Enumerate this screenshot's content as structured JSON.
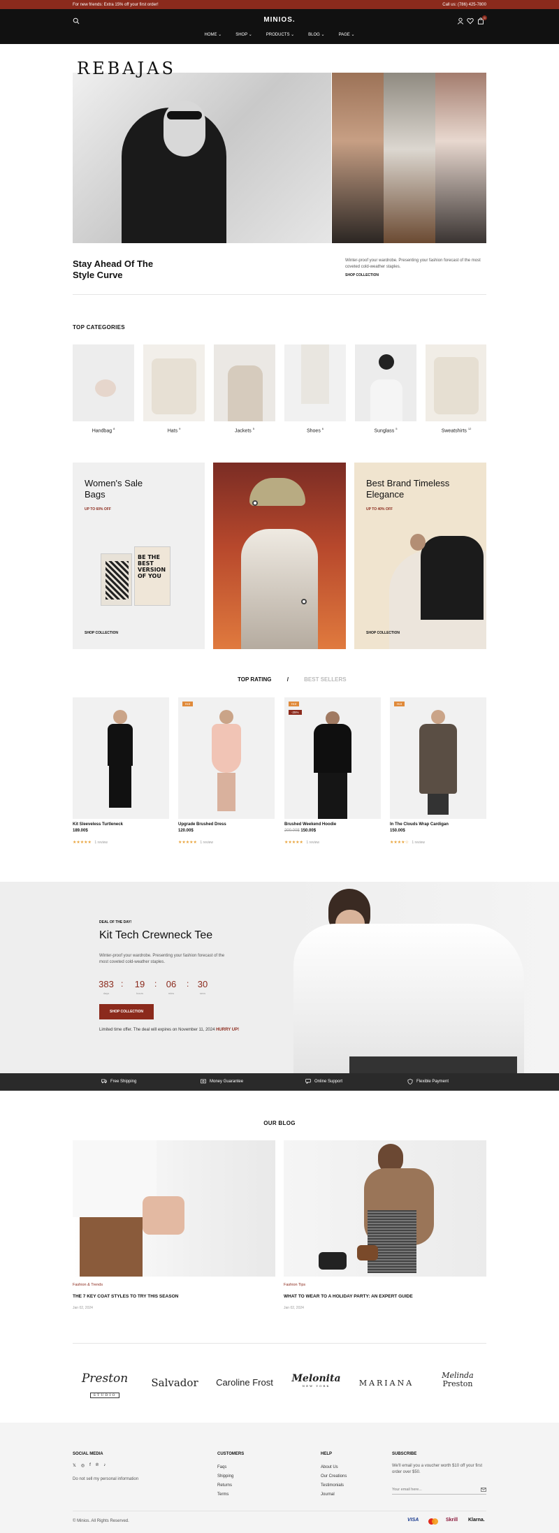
{
  "topbar": {
    "promo": "For new friends: Extra 15% off your first order!",
    "phone": "Call us: (786) 425-7800"
  },
  "header": {
    "brand": "MINIOS.",
    "nav": [
      "HOME",
      "SHOP",
      "PRODUCTS",
      "BLOG",
      "PAGE"
    ],
    "cart_count": "0"
  },
  "hero": {
    "overlay_text": "REBAJAS",
    "title": "Stay Ahead Of The Style Curve",
    "description": "Winter-proof your wardrobe. Presenting your fashion forecast of the most coveted cold-weather staples.",
    "link": "SHOP COLLECTION"
  },
  "categories": {
    "title": "TOP CATEGORIES",
    "items": [
      {
        "name": "Handbag",
        "count": "8"
      },
      {
        "name": "Hats",
        "count": "9"
      },
      {
        "name": "Jackets",
        "count": "5"
      },
      {
        "name": "Shoes",
        "count": "6"
      },
      {
        "name": "Sunglass",
        "count": "5"
      },
      {
        "name": "Sweatshirts",
        "count": "12"
      }
    ]
  },
  "promos": {
    "left": {
      "title": "Women's Sale Bags",
      "subtitle": "UP TO 60% OFF",
      "link": "SHOP COLLECTION",
      "bag_text": "BE THE BEST VERSION OF YOU"
    },
    "right": {
      "title": "Best Brand Timeless Elegance",
      "subtitle": "UP TO 40% OFF",
      "link": "SHOP COLLECTION"
    }
  },
  "products": {
    "tabs": [
      "TOP RATING",
      "/",
      "BEST SELLERS"
    ],
    "items": [
      {
        "name": "Kit Sleeveless Turtleneck",
        "price": "189.00$",
        "old_price": "",
        "badge": "",
        "discount": "",
        "stars": "★★★★★",
        "reviews": "1 review"
      },
      {
        "name": "Upgrade Brushed Dress",
        "price": "120.00$",
        "old_price": "",
        "badge": "Hot",
        "discount": "",
        "stars": "★★★★★",
        "reviews": "1 review"
      },
      {
        "name": "Brushed Weekend Hoodie",
        "price": "150.00$",
        "old_price": "200.00$",
        "badge": "Hot",
        "discount": "-25%",
        "stars": "★★★★★",
        "reviews": "1 review"
      },
      {
        "name": "In The Clouds Wrap Cardigan",
        "price": "150.00$",
        "old_price": "",
        "badge": "Hot",
        "discount": "",
        "stars": "★★★★☆",
        "reviews": "1 review"
      }
    ]
  },
  "deal": {
    "label": "DEAL OF THE DAY!",
    "title": "Kit Tech Crewneck Tee",
    "description": "Winter-proof your wardrobe. Presenting your fashion forecast of the most coveted cold-weather staples.",
    "countdown": [
      {
        "value": "383",
        "unit": "days"
      },
      {
        "value": "19",
        "unit": "hours"
      },
      {
        "value": "06",
        "unit": "mins"
      },
      {
        "value": "30",
        "unit": "secs"
      }
    ],
    "button": "SHOP COLLECTION",
    "note": "Limited time offer. The deal will expires on November 11, 2024",
    "note_highlight": "HURRY UP!"
  },
  "features": [
    "Free Shipping",
    "Money Guarantee",
    "Online Support",
    "Flexible Payment"
  ],
  "blog": {
    "title": "OUR BLOG",
    "posts": [
      {
        "category": "Fashion & Trends",
        "title": "THE 7 KEY COAT STYLES TO TRY THIS SEASON",
        "date": "Jan 02, 2024"
      },
      {
        "category": "Fashion Tips",
        "title": "WHAT TO WEAR TO A HOLIDAY PARTY: AN EXPERT GUIDE",
        "date": "Jan 02, 2024"
      }
    ]
  },
  "brands": [
    "Preston",
    "STUDIO",
    "Salvador",
    "Caroline Frost",
    "Melonita",
    "NEW YORK",
    "MARIANA",
    "Melinda",
    "Preston"
  ],
  "footer": {
    "social_title": "SOCIAL MEDIA",
    "privacy": "Do not sell my personal information",
    "customers_title": "CUSTOMERS",
    "customers": [
      "Faqs",
      "Shipping",
      "Returns",
      "Terms"
    ],
    "help_title": "HELP",
    "help": [
      "About Us",
      "Our Creations",
      "Testimonials",
      "Journal"
    ],
    "subscribe_title": "SUBSCRIBE",
    "subscribe_text": "We'll email you a voucher worth $10 off your first order over $50.",
    "email_placeholder": "Your email here...",
    "copyright": "© Minios. All Rights Reserved.",
    "payments": [
      "VISA",
      "Skrill",
      "Klarna."
    ]
  },
  "colors": {
    "accent": "#8b2a1c",
    "header": "#111111",
    "promo_beige": "#f0e4cf"
  }
}
